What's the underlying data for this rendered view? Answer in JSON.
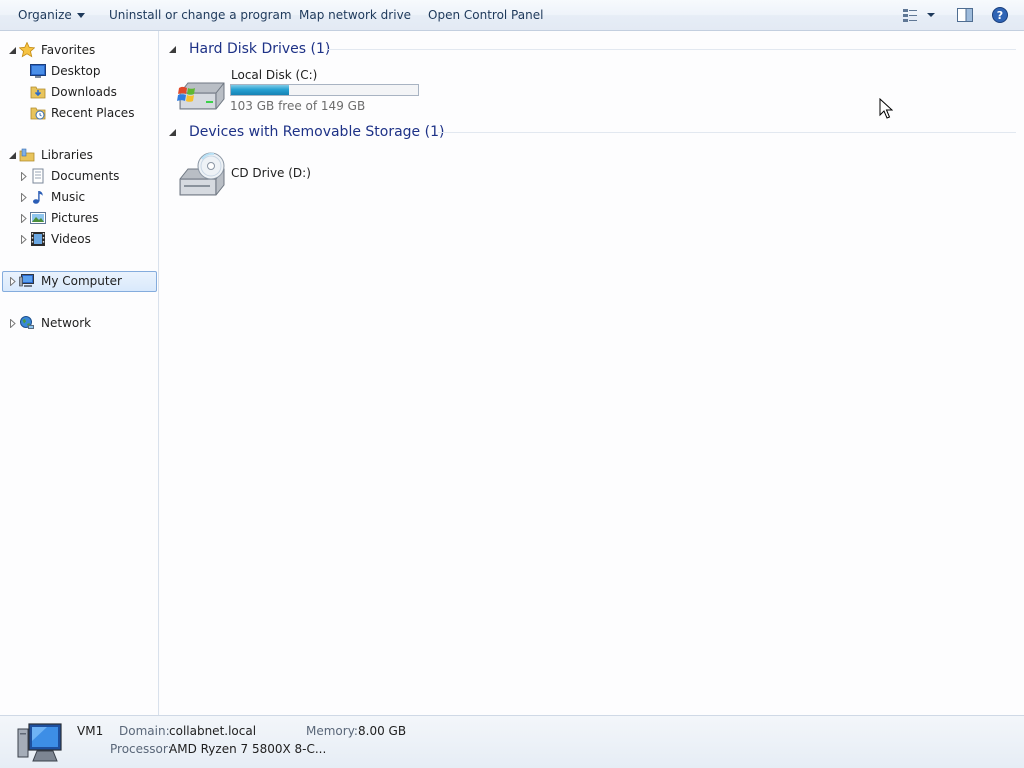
{
  "toolbar": {
    "organize": "Organize",
    "uninstall": "Uninstall or change a program",
    "map_drive": "Map network drive",
    "control_panel": "Open Control Panel"
  },
  "nav": {
    "favorites": {
      "label": "Favorites",
      "items": [
        "Desktop",
        "Downloads",
        "Recent Places"
      ]
    },
    "libraries": {
      "label": "Libraries",
      "items": [
        "Documents",
        "Music",
        "Pictures",
        "Videos"
      ]
    },
    "computer": "My Computer",
    "network": "Network"
  },
  "content": {
    "hard_disks": {
      "heading": "Hard Disk Drives (1)",
      "drives": [
        {
          "name": "Local Disk (C:)",
          "free_text": "103 GB free of 149 GB",
          "used_fraction": 0.31
        }
      ]
    },
    "removable": {
      "heading": "Devices with Removable Storage (1)",
      "drives": [
        {
          "name": "CD Drive (D:)"
        }
      ]
    }
  },
  "details": {
    "computer_name": "VM1",
    "domain_label": "Domain:",
    "domain_value": "collabnet.local",
    "memory_label": "Memory:",
    "memory_value": "8.00 GB",
    "processor_label": "Processor:",
    "processor_value": "AMD Ryzen 7 5800X 8-C..."
  },
  "colors": {
    "accent": "#1e3287",
    "selection": "#d9e9fc",
    "bar_fill": "#27a2d3"
  }
}
